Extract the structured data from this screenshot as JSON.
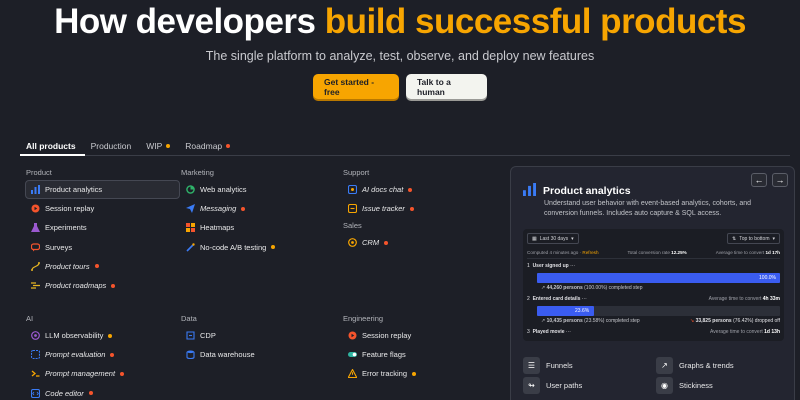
{
  "hero": {
    "title_part1": "How developers ",
    "title_accent": "build successful products",
    "subtitle": "The single platform to analyze, test, observe, and deploy new features",
    "cta_primary": "Get started - free",
    "cta_secondary": "Talk to a human"
  },
  "tabs": [
    {
      "label": "All products",
      "active": true,
      "dot": ""
    },
    {
      "label": "Production",
      "active": false,
      "dot": ""
    },
    {
      "label": "WIP",
      "active": false,
      "dot": "orange"
    },
    {
      "label": "Roadmap",
      "active": false,
      "dot": "red"
    }
  ],
  "sections": {
    "product": {
      "heading": "Product",
      "items": [
        {
          "label": "Product analytics",
          "icon": "bar-chart-icon"
        },
        {
          "label": "Session replay",
          "icon": "replay-icon"
        },
        {
          "label": "Experiments",
          "icon": "flask-icon"
        },
        {
          "label": "Surveys",
          "icon": "chat-bubble-icon"
        },
        {
          "label": "Product tours",
          "icon": "route-icon",
          "dot": "red"
        },
        {
          "label": "Product roadmaps",
          "icon": "roadmap-icon",
          "dot": "red"
        }
      ]
    },
    "marketing": {
      "heading": "Marketing",
      "items": [
        {
          "label": "Web analytics",
          "icon": "pie-chart-icon"
        },
        {
          "label": "Messaging",
          "icon": "send-icon",
          "dot": "red"
        },
        {
          "label": "Heatmaps",
          "icon": "heatmap-icon"
        },
        {
          "label": "No-code A/B testing",
          "icon": "wand-icon",
          "dot": "orange"
        }
      ]
    },
    "support": {
      "heading": "Support",
      "items": [
        {
          "label": "AI docs chat",
          "icon": "ai-chat-icon",
          "dot": "red"
        },
        {
          "label": "Issue tracker",
          "icon": "bug-icon",
          "dot": "red"
        }
      ]
    },
    "sales": {
      "heading": "Sales",
      "items": [
        {
          "label": "CRM",
          "icon": "crm-icon",
          "dot": "red"
        }
      ]
    },
    "ai": {
      "heading": "AI",
      "items": [
        {
          "label": "LLM observability",
          "icon": "llm-icon",
          "dot": "orange"
        },
        {
          "label": "Prompt evaluation",
          "icon": "eval-icon",
          "dot": "red"
        },
        {
          "label": "Prompt management",
          "icon": "prompt-icon",
          "dot": "red"
        },
        {
          "label": "Code editor",
          "icon": "code-icon",
          "dot": "red"
        }
      ]
    },
    "data": {
      "heading": "Data",
      "items": [
        {
          "label": "CDP",
          "icon": "cdp-icon"
        },
        {
          "label": "Data warehouse",
          "icon": "database-icon"
        }
      ]
    },
    "engineering": {
      "heading": "Engineering",
      "items": [
        {
          "label": "Session replay",
          "icon": "replay-icon"
        },
        {
          "label": "Feature flags",
          "icon": "toggle-icon"
        },
        {
          "label": "Error tracking",
          "icon": "warning-icon",
          "dot": "orange"
        }
      ]
    }
  },
  "panel": {
    "title": "Product analytics",
    "description": "Understand user behavior with event-based analytics, cohorts, and conversion funnels. Includes auto capture & SQL access.",
    "date_range": "Last 30 days",
    "sort": "Top to bottom",
    "computed": "Computed 4 minutes ago",
    "refresh": "Refresh",
    "conversion_label": "Total conversion rate",
    "conversion_value": "12.25%",
    "avg_time_label": "Average time to convert",
    "avg_time_value": "1d 17h",
    "steps": [
      {
        "num": "1",
        "name": "User signed up",
        "pct_label": "100.0%",
        "pct": 1.0,
        "completed": "44,260 persons",
        "completed_pct": "(100.00%) completed step",
        "right": "",
        "dropped": ""
      },
      {
        "num": "2",
        "name": "Entered card details",
        "pct_label": "23.6%",
        "pct": 0.236,
        "completed": "10,435 persons",
        "completed_pct": "(23.58%) completed step",
        "right_label": "Average time to convert",
        "right_value": "4h 33m",
        "dropped": "33,825 persons",
        "dropped_pct": "(76.42%) dropped off"
      },
      {
        "num": "3",
        "name": "Played movie",
        "right_label": "Average time to convert",
        "right_value": "1d 13h"
      }
    ],
    "features": [
      {
        "label": "Funnels",
        "icon": "funnel-icon"
      },
      {
        "label": "Graphs & trends",
        "icon": "trend-icon"
      },
      {
        "label": "User paths",
        "icon": "paths-icon"
      },
      {
        "label": "Stickiness",
        "icon": "stickiness-icon"
      }
    ]
  }
}
